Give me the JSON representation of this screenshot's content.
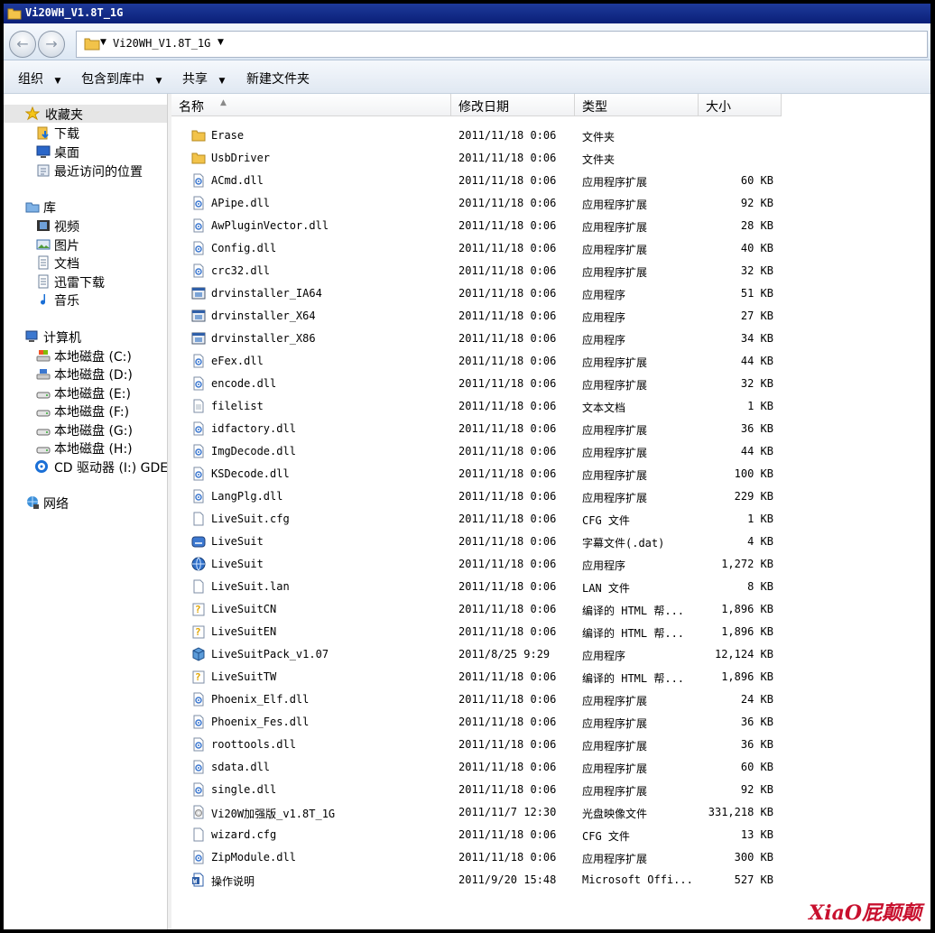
{
  "window": {
    "title": "Vi20WH_V1.8T_1G"
  },
  "address": {
    "crumb": "Vi20WH_V1.8T_1G"
  },
  "toolbar": {
    "organize": "组织",
    "include_in_library": "包含到库中",
    "share": "共享",
    "new_folder": "新建文件夹"
  },
  "sidebar": {
    "favorites": {
      "label": "收藏夹",
      "items": [
        "下载",
        "桌面",
        "最近访问的位置"
      ]
    },
    "libraries": {
      "label": "库",
      "items": [
        "视频",
        "图片",
        "文档",
        "迅雷下载",
        "音乐"
      ]
    },
    "computer": {
      "label": "计算机",
      "items": [
        "本地磁盘 (C:)",
        "本地磁盘 (D:)",
        "本地磁盘 (E:)",
        "本地磁盘 (F:)",
        "本地磁盘 (G:)",
        "本地磁盘 (H:)",
        "CD 驱动器 (I:) GDE"
      ]
    },
    "network": {
      "label": "网络"
    }
  },
  "columns": {
    "name": "名称",
    "date": "修改日期",
    "type": "类型",
    "size": "大小"
  },
  "files": [
    {
      "name": "Erase",
      "date": "2011/11/18 0:06",
      "type": "文件夹",
      "size": "",
      "icon": "folder-icon"
    },
    {
      "name": "UsbDriver",
      "date": "2011/11/18 0:06",
      "type": "文件夹",
      "size": "",
      "icon": "folder-icon"
    },
    {
      "name": "ACmd.dll",
      "date": "2011/11/18 0:06",
      "type": "应用程序扩展",
      "size": "60 KB",
      "icon": "dll-icon"
    },
    {
      "name": "APipe.dll",
      "date": "2011/11/18 0:06",
      "type": "应用程序扩展",
      "size": "92 KB",
      "icon": "dll-icon"
    },
    {
      "name": "AwPluginVector.dll",
      "date": "2011/11/18 0:06",
      "type": "应用程序扩展",
      "size": "28 KB",
      "icon": "dll-icon"
    },
    {
      "name": "Config.dll",
      "date": "2011/11/18 0:06",
      "type": "应用程序扩展",
      "size": "40 KB",
      "icon": "dll-icon"
    },
    {
      "name": "crc32.dll",
      "date": "2011/11/18 0:06",
      "type": "应用程序扩展",
      "size": "32 KB",
      "icon": "dll-icon"
    },
    {
      "name": "drvinstaller_IA64",
      "date": "2011/11/18 0:06",
      "type": "应用程序",
      "size": "51 KB",
      "icon": "exe-icon"
    },
    {
      "name": "drvinstaller_X64",
      "date": "2011/11/18 0:06",
      "type": "应用程序",
      "size": "27 KB",
      "icon": "exe-icon"
    },
    {
      "name": "drvinstaller_X86",
      "date": "2011/11/18 0:06",
      "type": "应用程序",
      "size": "34 KB",
      "icon": "exe-icon"
    },
    {
      "name": "eFex.dll",
      "date": "2011/11/18 0:06",
      "type": "应用程序扩展",
      "size": "44 KB",
      "icon": "dll-icon"
    },
    {
      "name": "encode.dll",
      "date": "2011/11/18 0:06",
      "type": "应用程序扩展",
      "size": "32 KB",
      "icon": "dll-icon"
    },
    {
      "name": "filelist",
      "date": "2011/11/18 0:06",
      "type": "文本文档",
      "size": "1 KB",
      "icon": "text-file-icon"
    },
    {
      "name": "idfactory.dll",
      "date": "2011/11/18 0:06",
      "type": "应用程序扩展",
      "size": "36 KB",
      "icon": "dll-icon"
    },
    {
      "name": "ImgDecode.dll",
      "date": "2011/11/18 0:06",
      "type": "应用程序扩展",
      "size": "44 KB",
      "icon": "dll-icon"
    },
    {
      "name": "KSDecode.dll",
      "date": "2011/11/18 0:06",
      "type": "应用程序扩展",
      "size": "100 KB",
      "icon": "dll-icon"
    },
    {
      "name": "LangPlg.dll",
      "date": "2011/11/18 0:06",
      "type": "应用程序扩展",
      "size": "229 KB",
      "icon": "dll-icon"
    },
    {
      "name": "LiveSuit.cfg",
      "date": "2011/11/18 0:06",
      "type": "CFG 文件",
      "size": "1 KB",
      "icon": "blank-file-icon"
    },
    {
      "name": "LiveSuit",
      "date": "2011/11/18 0:06",
      "type": "字幕文件(.dat)",
      "size": "4 KB",
      "icon": "dat-file-icon"
    },
    {
      "name": "LiveSuit",
      "date": "2011/11/18 0:06",
      "type": "应用程序",
      "size": "1,272 KB",
      "icon": "globe-app-icon"
    },
    {
      "name": "LiveSuit.lan",
      "date": "2011/11/18 0:06",
      "type": "LAN 文件",
      "size": "8 KB",
      "icon": "blank-file-icon"
    },
    {
      "name": "LiveSuitCN",
      "date": "2011/11/18 0:06",
      "type": "编译的 HTML 帮...",
      "size": "1,896 KB",
      "icon": "chm-help-icon"
    },
    {
      "name": "LiveSuitEN",
      "date": "2011/11/18 0:06",
      "type": "编译的 HTML 帮...",
      "size": "1,896 KB",
      "icon": "chm-help-icon"
    },
    {
      "name": "LiveSuitPack_v1.07",
      "date": "2011/8/25 9:29",
      "type": "应用程序",
      "size": "12,124 KB",
      "icon": "installer-box-icon"
    },
    {
      "name": "LiveSuitTW",
      "date": "2011/11/18 0:06",
      "type": "编译的 HTML 帮...",
      "size": "1,896 KB",
      "icon": "chm-help-icon"
    },
    {
      "name": "Phoenix_Elf.dll",
      "date": "2011/11/18 0:06",
      "type": "应用程序扩展",
      "size": "24 KB",
      "icon": "dll-icon"
    },
    {
      "name": "Phoenix_Fes.dll",
      "date": "2011/11/18 0:06",
      "type": "应用程序扩展",
      "size": "36 KB",
      "icon": "dll-icon"
    },
    {
      "name": "roottools.dll",
      "date": "2011/11/18 0:06",
      "type": "应用程序扩展",
      "size": "36 KB",
      "icon": "dll-icon"
    },
    {
      "name": "sdata.dll",
      "date": "2011/11/18 0:06",
      "type": "应用程序扩展",
      "size": "60 KB",
      "icon": "dll-icon"
    },
    {
      "name": "single.dll",
      "date": "2011/11/18 0:06",
      "type": "应用程序扩展",
      "size": "92 KB",
      "icon": "dll-icon"
    },
    {
      "name": "Vi20W加强版_v1.8T_1G",
      "date": "2011/11/7 12:30",
      "type": "光盘映像文件",
      "size": "331,218 KB",
      "icon": "disc-image-icon"
    },
    {
      "name": "wizard.cfg",
      "date": "2011/11/18 0:06",
      "type": "CFG 文件",
      "size": "13 KB",
      "icon": "blank-file-icon"
    },
    {
      "name": "ZipModule.dll",
      "date": "2011/11/18 0:06",
      "type": "应用程序扩展",
      "size": "300 KB",
      "icon": "dll-icon"
    },
    {
      "name": "操作说明",
      "date": "2011/9/20 15:48",
      "type": "Microsoft Offi...",
      "size": "527 KB",
      "icon": "word-doc-icon"
    }
  ],
  "watermark": "XiaO屁颠颠"
}
